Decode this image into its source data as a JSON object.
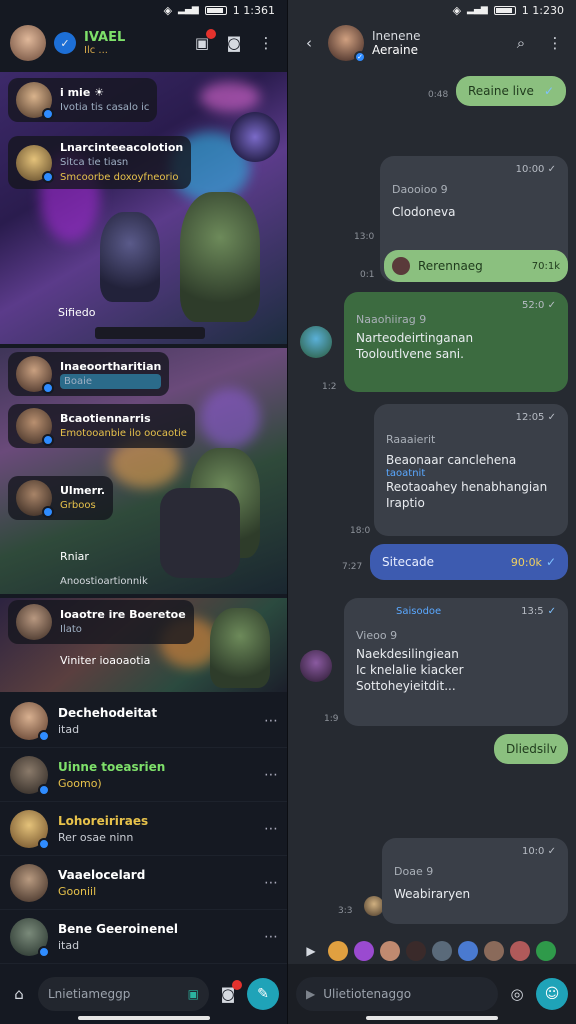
{
  "left": {
    "status": {
      "time": "1 1:361"
    },
    "header": {
      "title": "IVAEL",
      "subtitle": "Ilc ..."
    },
    "cards": [
      {
        "pills": [
          {
            "title": "i mie ☀",
            "sub": "Ivotia tis casalo ic"
          },
          {
            "title": "Lnarcinteeacolotion",
            "sub": "Sitca tie tiasn",
            "extra": "Smcoorbe doxoyfneorio"
          }
        ],
        "caption": "Sifiedo"
      },
      {
        "pills": [
          {
            "title": "Inaeoortharitian",
            "sub": "Boaie"
          },
          {
            "title": "Bcaotiennarris",
            "sub": "Emotooanbie ilo oocaotie"
          },
          {
            "title": "Ulmerr.",
            "sub": "Grboos"
          }
        ],
        "caption": "Rniar",
        "caption2": "Anoostioartionnik"
      },
      {
        "pills": [
          {
            "title": "Ioaotre ire Boeretoe",
            "sub": "Ilato"
          }
        ],
        "caption": "Viniter ioaoaotia"
      }
    ],
    "chats": [
      {
        "name": "Dechehodeitat",
        "preview": "itad"
      },
      {
        "name": "Uinne toeasrien",
        "preview": "Goomo)"
      },
      {
        "name": "Lohoreiriraes",
        "preview": "Rer osae ninn"
      },
      {
        "name": "Vaaelocelard",
        "preview": "Gooniil"
      },
      {
        "name": "Bene Geeroinenel",
        "preview": "itad"
      }
    ],
    "input_placeholder": "Lnietiameggp"
  },
  "right": {
    "status": {
      "time": "1 1:230"
    },
    "header": {
      "title": "Inenene",
      "subtitle": "Aeraine"
    },
    "messages": [
      {
        "text": "Reaine live",
        "side": "0:48"
      },
      {
        "meta": "Daooioo 9",
        "text": "Clodoneva",
        "time": "10:00",
        "side": "13:0"
      },
      {
        "text": "Rerennaeg",
        "time": "70:1k",
        "side": "0:1"
      },
      {
        "meta": "Naaohiirag 9",
        "lines": [
          "Narteodeirtinganan",
          "Tooloutlvene sani."
        ],
        "time": "52:0",
        "side": "1:2"
      },
      {
        "meta": "Raaaierit",
        "link": "taoatnit",
        "lines": [
          "Beaonaar canclehena",
          "Reotaoahey henabhangian",
          "Iraptio"
        ],
        "time": "12:05",
        "side": "18:0"
      },
      {
        "text": "Sitecade",
        "time": "90:0k",
        "side": "7:27"
      },
      {
        "meta": "Saisodoe",
        "lines": [
          "Naekdesilingiean",
          "Ic knelalie kiacker",
          "Sottoheyieitdit..."
        ],
        "time": "13:5",
        "sub": "Vieoo 9",
        "side": "1:9"
      },
      {
        "text": "Dliedsilv",
        "side": ""
      },
      {
        "meta": "Doae 9",
        "text": "Weabiraryen",
        "time": "10:0",
        "side": "3:3"
      }
    ],
    "input_placeholder": "Ulietiotenaggo"
  }
}
